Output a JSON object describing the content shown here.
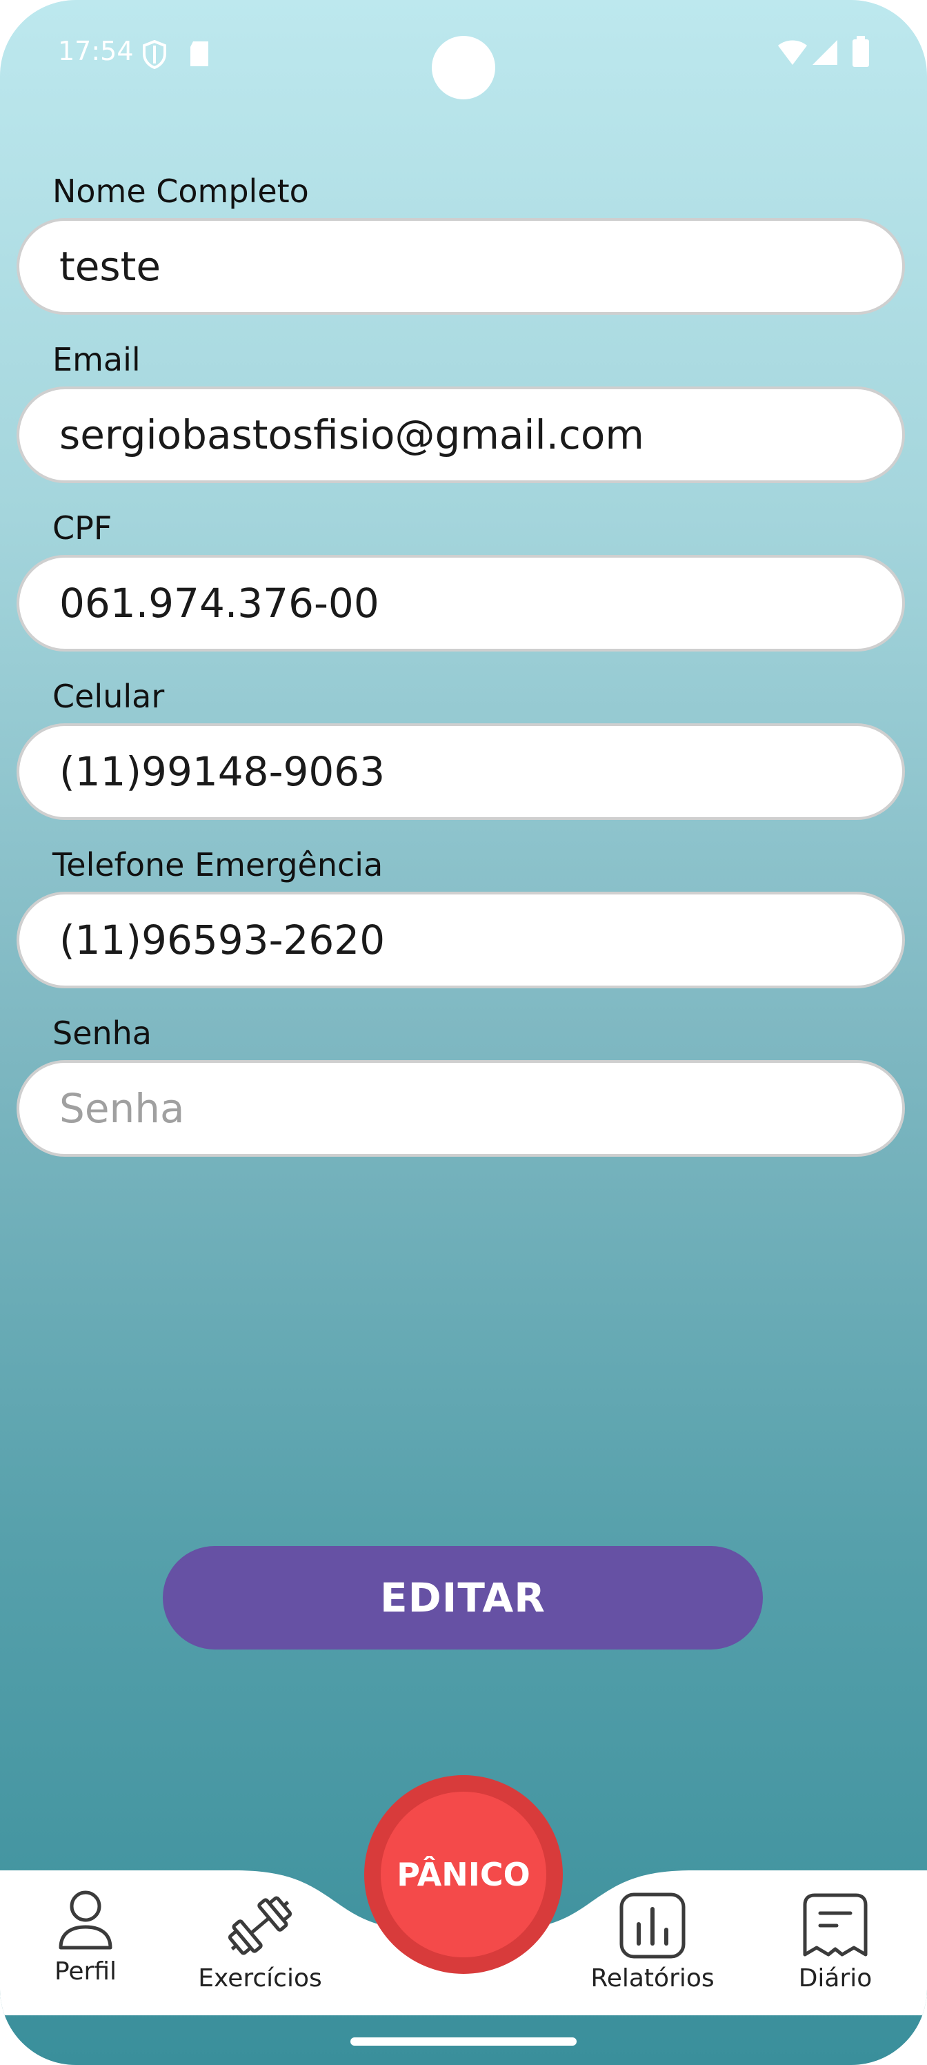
{
  "status": {
    "time": "17:54"
  },
  "form": {
    "fields": [
      {
        "label": "Nome Completo",
        "value": "teste",
        "placeholder": ""
      },
      {
        "label": "Email",
        "value": "sergiobastosfisio@gmail.com",
        "placeholder": ""
      },
      {
        "label": "CPF",
        "value": "061.974.376-00",
        "placeholder": ""
      },
      {
        "label": "Celular",
        "value": "(11)99148-9063",
        "placeholder": ""
      },
      {
        "label": "Telefone Emergência",
        "value": "(11)96593-2620",
        "placeholder": ""
      },
      {
        "label": "Senha",
        "value": "",
        "placeholder": "Senha"
      }
    ],
    "edit_label": "EDITAR"
  },
  "panic": {
    "label": "PÂNICO",
    "color": "#f44a4a"
  },
  "nav": {
    "items": [
      {
        "label": "Perfil",
        "icon": "user-icon"
      },
      {
        "label": "Exercícios",
        "icon": "dumbbell-icon"
      },
      {
        "label": "Relatórios",
        "icon": "bar-chart-icon"
      },
      {
        "label": "Diário",
        "icon": "journal-icon"
      }
    ]
  },
  "colors": {
    "accent": "#6651a4",
    "gradient_top": "#bde8ee",
    "gradient_bottom": "#3a8f9b"
  }
}
